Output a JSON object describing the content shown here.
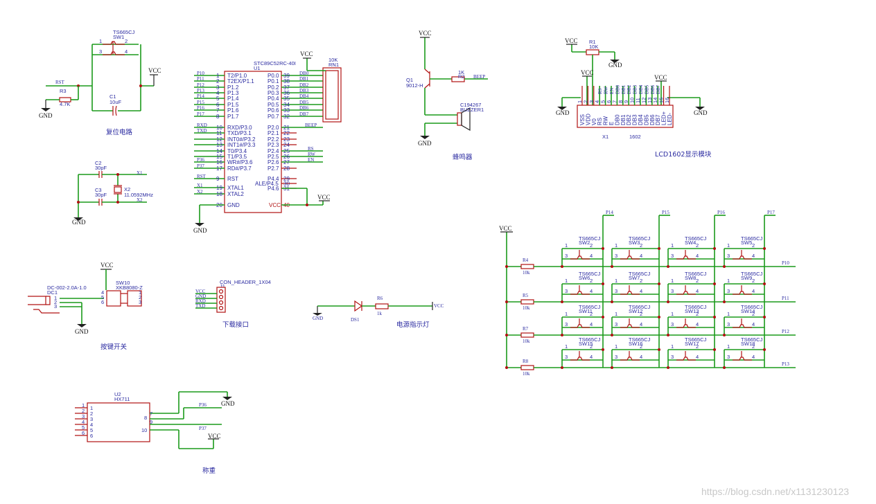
{
  "reset_block": {
    "sw_part": "TS665CJ",
    "sw_ref": "SW1",
    "pin1": "1",
    "pin2": "2",
    "pin3": "3",
    "pin4": "4",
    "rst_net": "RST",
    "r_ref": "R3",
    "r_val": "4.7K",
    "c_ref": "C1",
    "c_val": "10uF",
    "vcc": "VCC",
    "gnd": "GND",
    "caption": "复位电路"
  },
  "crystal_block": {
    "c2_ref": "C2",
    "c2_val": "30pF",
    "c3_ref": "C3",
    "c3_val": "30pF",
    "x_ref": "X2",
    "x_val": "11.0592MHz",
    "net_x1": "X1",
    "net_x2": "X2",
    "gnd": "GND"
  },
  "mcu_block": {
    "part": "STC89C52RC-40I",
    "ref": "U1",
    "left_pins": [
      {
        "net": "P10",
        "num": "1",
        "name": "T2/P1.0"
      },
      {
        "net": "P11",
        "num": "2",
        "name": "T2EX/P1.1"
      },
      {
        "net": "P12",
        "num": "3",
        "name": "P1.2"
      },
      {
        "net": "P13",
        "num": "4",
        "name": "P1.3"
      },
      {
        "net": "P14",
        "num": "5",
        "name": "P1.4"
      },
      {
        "net": "P15",
        "num": "6",
        "name": "P1.5"
      },
      {
        "net": "P16",
        "num": "7",
        "name": "P1.6"
      },
      {
        "net": "P17",
        "num": "8",
        "name": "P1.7"
      },
      {
        "net": "RXD",
        "num": "10",
        "name": "RXD/P3.0"
      },
      {
        "net": "TXD",
        "num": "11",
        "name": "TXD/P3.1"
      },
      {
        "net": "",
        "num": "12",
        "name": "INT0#/P3.2"
      },
      {
        "net": "",
        "num": "13",
        "name": "INT1#/P3.3"
      },
      {
        "net": "",
        "num": "14",
        "name": "T0/P3.4"
      },
      {
        "net": "",
        "num": "15",
        "name": "T1/P3.5"
      },
      {
        "net": "P36",
        "num": "16",
        "name": "WR#/P3.6"
      },
      {
        "net": "P37",
        "num": "17",
        "name": "RD#/P3.7"
      },
      {
        "net": "RST",
        "num": "9",
        "name": "RST"
      },
      {
        "net": "X1",
        "num": "19",
        "name": "XTAL1"
      },
      {
        "net": "X2",
        "num": "18",
        "name": "XTAL2"
      },
      {
        "net": "",
        "num": "20",
        "name": "GND"
      }
    ],
    "right_pins": [
      {
        "net": "DB0",
        "num": "39",
        "name": "P0.0"
      },
      {
        "net": "DB1",
        "num": "38",
        "name": "P0.1"
      },
      {
        "net": "DB2",
        "num": "37",
        "name": "P0.2"
      },
      {
        "net": "DB3",
        "num": "36",
        "name": "P0.3"
      },
      {
        "net": "DB4",
        "num": "35",
        "name": "P0.4"
      },
      {
        "net": "DB5",
        "num": "34",
        "name": "P0.5"
      },
      {
        "net": "DB6",
        "num": "33",
        "name": "P0.6"
      },
      {
        "net": "DB7",
        "num": "32",
        "name": "P0.7"
      },
      {
        "net": "BEEP",
        "num": "21",
        "name": "P2.0"
      },
      {
        "net": "",
        "num": "22",
        "name": "P2.1"
      },
      {
        "net": "",
        "num": "23",
        "name": "P2.2"
      },
      {
        "net": "",
        "num": "24",
        "name": "P2.3"
      },
      {
        "net": "RS",
        "num": "25",
        "name": "P2.4"
      },
      {
        "net": "RW",
        "num": "26",
        "name": "P2.5"
      },
      {
        "net": "EN",
        "num": "27",
        "name": "P2.6"
      },
      {
        "net": "",
        "num": "28",
        "name": "P2.7"
      },
      {
        "net": "",
        "num": "29",
        "name": "P4.4"
      },
      {
        "net": "",
        "num": "30",
        "name": "ALE/P4.5"
      },
      {
        "net": "",
        "num": "31",
        "name": "P4.6"
      },
      {
        "net": "",
        "num": "40",
        "name": "VCC"
      }
    ],
    "rn_val": "10K",
    "rn_ref": "RN1",
    "vcc": "VCC",
    "gnd": "GND"
  },
  "buzzer_block": {
    "vcc": "VCC",
    "q_ref": "Q1",
    "q_val": "9012-H",
    "r_val": "1K",
    "r_ref": "R2",
    "net": "BEEP",
    "bz_part": "C194267",
    "bz_ref": "BUZZER1",
    "gnd": "GND",
    "caption": "蜂鸣器"
  },
  "lcd_block": {
    "vcc1": "VCC",
    "r_ref": "R1",
    "r_val": "10K",
    "gnd_top": "GND",
    "vcc2": "VCC",
    "vcc3": "VCC",
    "gnd_left": "GND",
    "gnd_right": "GND",
    "pins": [
      "VSS",
      "VDD",
      "V0",
      "RS",
      "RW",
      "E",
      "DB0",
      "DB1",
      "DB2",
      "DB3",
      "DB4",
      "DB5",
      "DB6",
      "DB7",
      "LED+",
      "LED-"
    ],
    "nums": [
      "1",
      "2",
      "3",
      "4",
      "5",
      "6",
      "7",
      "8",
      "9",
      "10",
      "11",
      "12",
      "13",
      "14",
      "15",
      "16"
    ],
    "nets": [
      "",
      "",
      "",
      "RS",
      "RW",
      "EN",
      "DB0",
      "DB1",
      "DB2",
      "DB3",
      "DB4",
      "DB5",
      "DB6",
      "DB7",
      "",
      ""
    ],
    "ref": "X1",
    "part": "1602",
    "caption": "LCD1602显示模块"
  },
  "dc_block": {
    "vcc": "VCC",
    "dc_part": "DC-002-2.0A-1.0",
    "dc_ref": "DC1",
    "sw_ref": "SW10",
    "sw_part": "XKB8080-Z",
    "gnd": "GND",
    "caption": "按键开关",
    "pins": [
      "1",
      "2",
      "3",
      "4",
      "5",
      "6",
      "1",
      "2",
      "3"
    ]
  },
  "header_block": {
    "part": "CON_HEADER_1X04",
    "ref": "J1",
    "nets": [
      "VCC",
      "GND",
      "RXD",
      "TXD"
    ],
    "caption": "下载接口"
  },
  "led_block": {
    "gnd": "GND",
    "led_ref": "DS1",
    "r_ref": "R6",
    "r_val": "1k",
    "vcc": "VCC",
    "caption": "电源指示灯"
  },
  "hx_block": {
    "ref": "U2",
    "part": "HX711",
    "left_pins": [
      "1",
      "2",
      "3",
      "4",
      "5",
      "6"
    ],
    "right_pins": [
      "7",
      "8",
      "9",
      "10"
    ],
    "gnd": "GND",
    "net1": "P36",
    "net2": "P37",
    "vcc": "VCC",
    "caption": "称重"
  },
  "keypad_block": {
    "vcc": "VCC",
    "col_nets": [
      "P14",
      "P15",
      "P16",
      "P17"
    ],
    "row_nets": [
      "P10",
      "P11",
      "P12",
      "P13"
    ],
    "row_res": [
      {
        "ref": "R4",
        "val": "10k"
      },
      {
        "ref": "R5",
        "val": "10k"
      },
      {
        "ref": "R7",
        "val": "10k"
      },
      {
        "ref": "R8",
        "val": "10k"
      }
    ],
    "sw_part": "TS665CJ",
    "sw_refs": [
      "SW2",
      "SW3",
      "SW4",
      "SW5",
      "SW6",
      "SW7",
      "SW8",
      "SW9",
      "SW11",
      "SW12",
      "SW13",
      "SW14",
      "SW15",
      "SW16",
      "SW17",
      "SW18"
    ],
    "sw_pins": [
      "1",
      "2",
      "3",
      "4"
    ]
  },
  "watermark": "https://blog.csdn.net/x1131230123"
}
